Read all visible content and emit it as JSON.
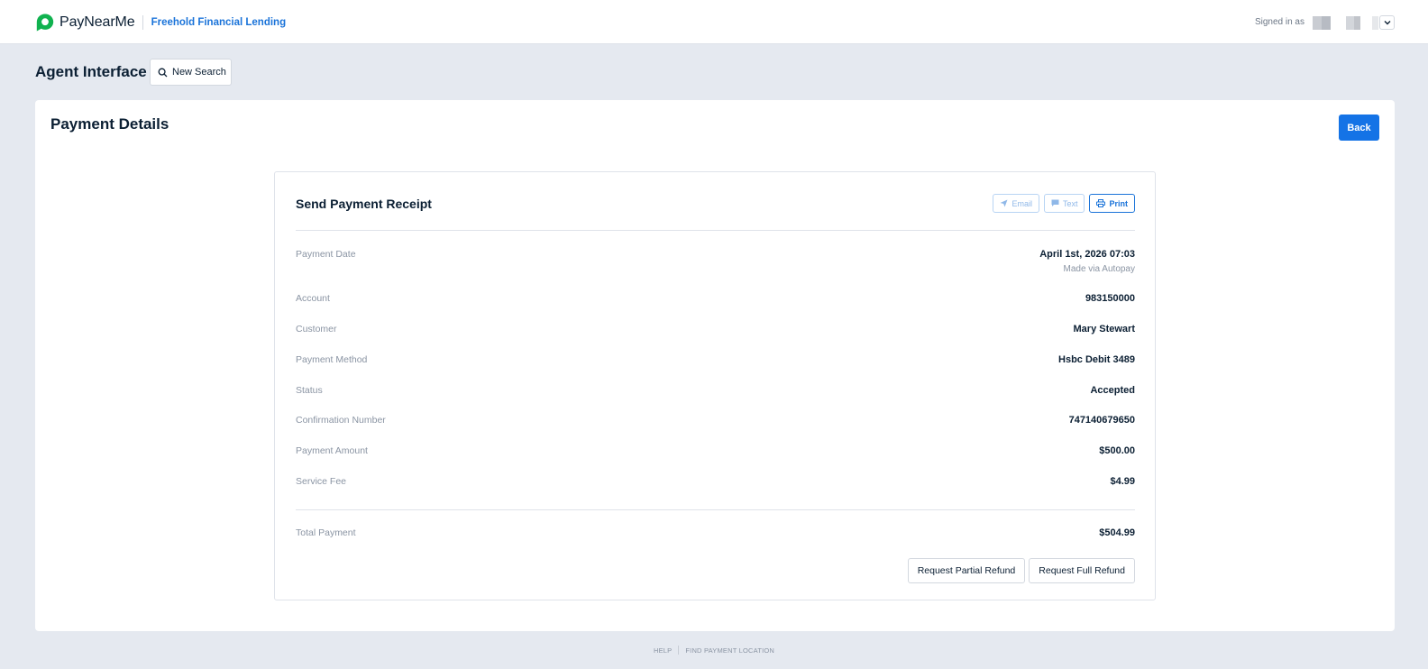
{
  "header": {
    "brand": "PayNearMe",
    "merchant": "Freehold Financial Lending",
    "signed_in_label": "Signed in as",
    "brand_color": "#10b24f",
    "accent_color": "#1473e6"
  },
  "agent": {
    "title": "Agent Interface",
    "new_search_label": "New Search"
  },
  "panel": {
    "title": "Payment Details",
    "back_label": "Back"
  },
  "receipt": {
    "title": "Send Payment Receipt",
    "email_label": "Email",
    "text_label": "Text",
    "print_label": "Print"
  },
  "details": [
    {
      "label": "Payment Date",
      "value": "April 1st, 2026 07:03",
      "sub": "Made via Autopay"
    },
    {
      "label": "Account",
      "value": "983150000"
    },
    {
      "label": "Customer",
      "value": "Mary Stewart"
    },
    {
      "label": "Payment Method",
      "value": "Hsbc Debit 3489"
    },
    {
      "label": "Status",
      "value": "Accepted"
    },
    {
      "label": "Confirmation Number",
      "value": "747140679650"
    },
    {
      "label": "Payment Amount",
      "value": "$500.00"
    },
    {
      "label": "Service Fee",
      "value": "$4.99"
    }
  ],
  "total": {
    "label": "Total Payment",
    "value": "$504.99"
  },
  "actions": {
    "partial_refund": "Request Partial Refund",
    "full_refund": "Request Full Refund"
  },
  "footer": {
    "help": "HELP",
    "find_location": "FIND PAYMENT LOCATION"
  }
}
